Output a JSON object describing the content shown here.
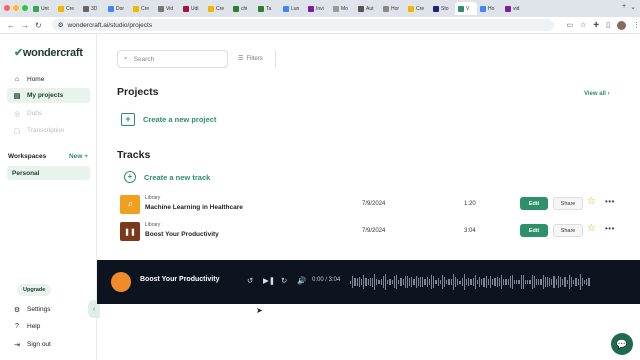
{
  "browser": {
    "tabs": [
      "Unt",
      "Cre",
      "3D",
      "Dor",
      "Cre",
      "Vid",
      "Udi",
      "Cre",
      "chi",
      "Ta",
      "Lun",
      "Invi",
      "Mo",
      "Aut",
      "Hor",
      "Cre",
      "Sto",
      "V",
      "Ho",
      "vid"
    ],
    "url": "wondercraft.ai/studio/projects"
  },
  "sidebar": {
    "logo": "wondercraft",
    "items": [
      {
        "label": "Home",
        "icon": "home-icon"
      },
      {
        "label": "My projects",
        "icon": "folder-icon"
      },
      {
        "label": "Dubs",
        "icon": "globe-icon"
      },
      {
        "label": "Transcription",
        "icon": "transcript-icon"
      }
    ],
    "workspaces_label": "Workspaces",
    "new_label": "New",
    "workspace": "Personal",
    "upgrade": "Upgrade",
    "bottom": [
      {
        "label": "Settings",
        "icon": "gear-icon"
      },
      {
        "label": "Help",
        "icon": "help-icon"
      },
      {
        "label": "Sign out",
        "icon": "signout-icon"
      }
    ]
  },
  "main": {
    "search_placeholder": "Search",
    "filters": "Filters",
    "projects_heading": "Projects",
    "view_all": "View all",
    "create_project": "Create a new project",
    "tracks_heading": "Tracks",
    "create_track": "Create a new track",
    "tracks": [
      {
        "library": "Library",
        "title": "Machine Learning in Healthcare",
        "date": "7/9/2024",
        "duration": "1:20",
        "edit": "Edit",
        "share": "Share",
        "thumb_color": "#f0a020"
      },
      {
        "library": "Library",
        "title": "Boost Your Productivity",
        "date": "7/9/2024",
        "duration": "3:04",
        "edit": "Edit",
        "share": "Share",
        "thumb_color": "#7a3a1a"
      }
    ]
  },
  "player": {
    "title": "Boost Your Productivity",
    "time": "0:00 / 3:04"
  }
}
